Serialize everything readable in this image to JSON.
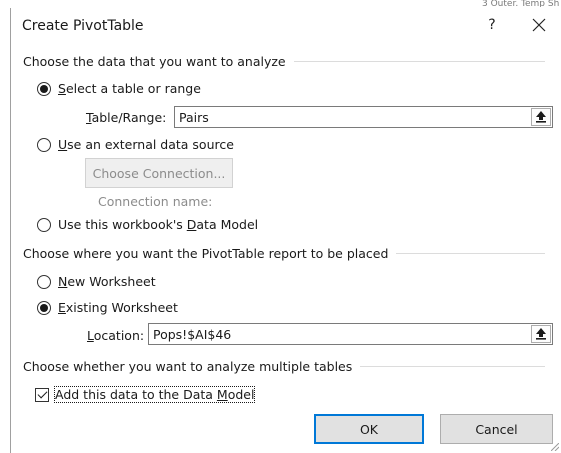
{
  "dialog": {
    "title": "Create PivotTable",
    "help_label": "?",
    "close_label": "✕",
    "background_text": "3 Outer. Temp Sh"
  },
  "section_data": {
    "header": "Choose the data that you want to analyze",
    "option_table": {
      "prefix": "",
      "accel": "S",
      "suffix": "elect a table or range",
      "checked": true
    },
    "table_range": {
      "accel": "T",
      "label_rest": "able/Range:",
      "value": "Pairs"
    },
    "option_external": {
      "prefix": "",
      "accel": "U",
      "suffix": "se an external data source",
      "checked": false
    },
    "choose_connection": "Choose Connection...",
    "connection_name_label": "Connection name:",
    "option_data_model": {
      "prefix": "Use this workbook's ",
      "accel": "D",
      "suffix": "ata Model",
      "checked": false
    }
  },
  "section_location": {
    "header": "Choose where you want the PivotTable report to be placed",
    "option_new": {
      "prefix": "",
      "accel": "N",
      "suffix": "ew Worksheet",
      "checked": false
    },
    "option_existing": {
      "prefix": "",
      "accel": "E",
      "suffix": "xisting Worksheet",
      "checked": true
    },
    "location": {
      "accel": "L",
      "label_rest": "ocation:",
      "value": "Pops!$AI$46"
    }
  },
  "section_multiple": {
    "header": "Choose whether you want to analyze multiple tables",
    "add_model": {
      "prefix": "Add this data to the Data ",
      "accel": "M",
      "suffix": "odel",
      "checked": true
    }
  },
  "buttons": {
    "ok": "OK",
    "cancel": "Cancel"
  },
  "colors": {
    "ok_border": "#0078d7",
    "text": "#1a1a1a",
    "disabled_text": "#8c8c8c"
  }
}
